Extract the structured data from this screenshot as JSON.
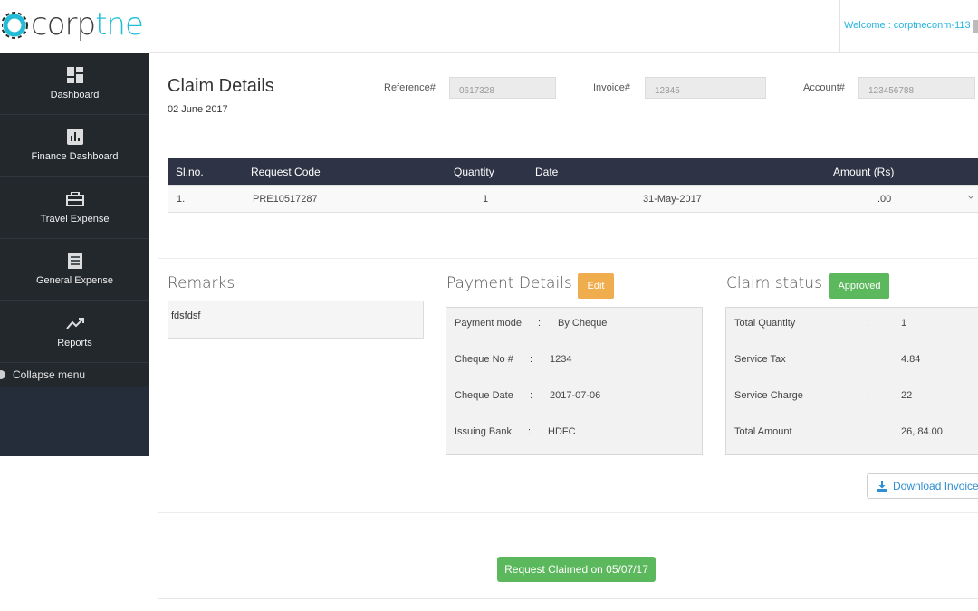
{
  "logo": {
    "part1": "corp",
    "part2": "tne"
  },
  "header": {
    "welcome": "Welcome : corptneconm-113"
  },
  "sidebar": {
    "items": [
      {
        "label": "Dashboard",
        "icon": "dashboard-icon"
      },
      {
        "label": "Finance Dashboard",
        "icon": "bar-chart-icon"
      },
      {
        "label": "Travel Expense",
        "icon": "briefcase-icon"
      },
      {
        "label": "General Expense",
        "icon": "document-icon"
      },
      {
        "label": "Reports",
        "icon": "trend-line-icon"
      }
    ],
    "collapse_label": "Collapse menu"
  },
  "claim": {
    "title": "Claim Details",
    "date": "02 June 2017",
    "reference_label": "Reference#",
    "reference_value": "0617328",
    "invoice_label": "Invoice#",
    "invoice_value": "12345",
    "account_label": "Account#",
    "account_value": "123456788"
  },
  "table": {
    "headers": [
      "Sl.no.",
      "Request Code",
      "Quantity",
      "Date",
      "Amount (Rs)"
    ],
    "rows": [
      {
        "sl": "1.",
        "code": "PRE10517287",
        "quantity": "1",
        "date": "31-May-2017",
        "amount": ".00"
      }
    ]
  },
  "remarks": {
    "title": "Remarks",
    "text": "fdsfdsf"
  },
  "payment": {
    "title": "Payment Details :",
    "edit_label": "Edit",
    "rows": [
      {
        "label": "Payment mode",
        "value": "By Cheque"
      },
      {
        "label": "Cheque No #",
        "value": "1234"
      },
      {
        "label": "Cheque Date",
        "value": "2017-07-06"
      },
      {
        "label": "Issuing Bank",
        "value": "HDFC"
      }
    ]
  },
  "status": {
    "title": "Claim status :",
    "badge": "Approved",
    "rows": [
      {
        "label": "Total Quantity",
        "value": "1"
      },
      {
        "label": "Service Tax",
        "value": "4.84"
      },
      {
        "label": "Service Charge",
        "value": "22"
      },
      {
        "label": "Total Amount",
        "value": "26,.84.00"
      }
    ]
  },
  "actions": {
    "download_label": "Download Invoice",
    "claimed_label": "Request Claimed on 05/07/17"
  },
  "colors": {
    "sidebar": "#23282d",
    "table_header": "#2e3446",
    "accent": "#22bcd6",
    "success": "#5cb85c",
    "warning": "#f0ad4e"
  }
}
